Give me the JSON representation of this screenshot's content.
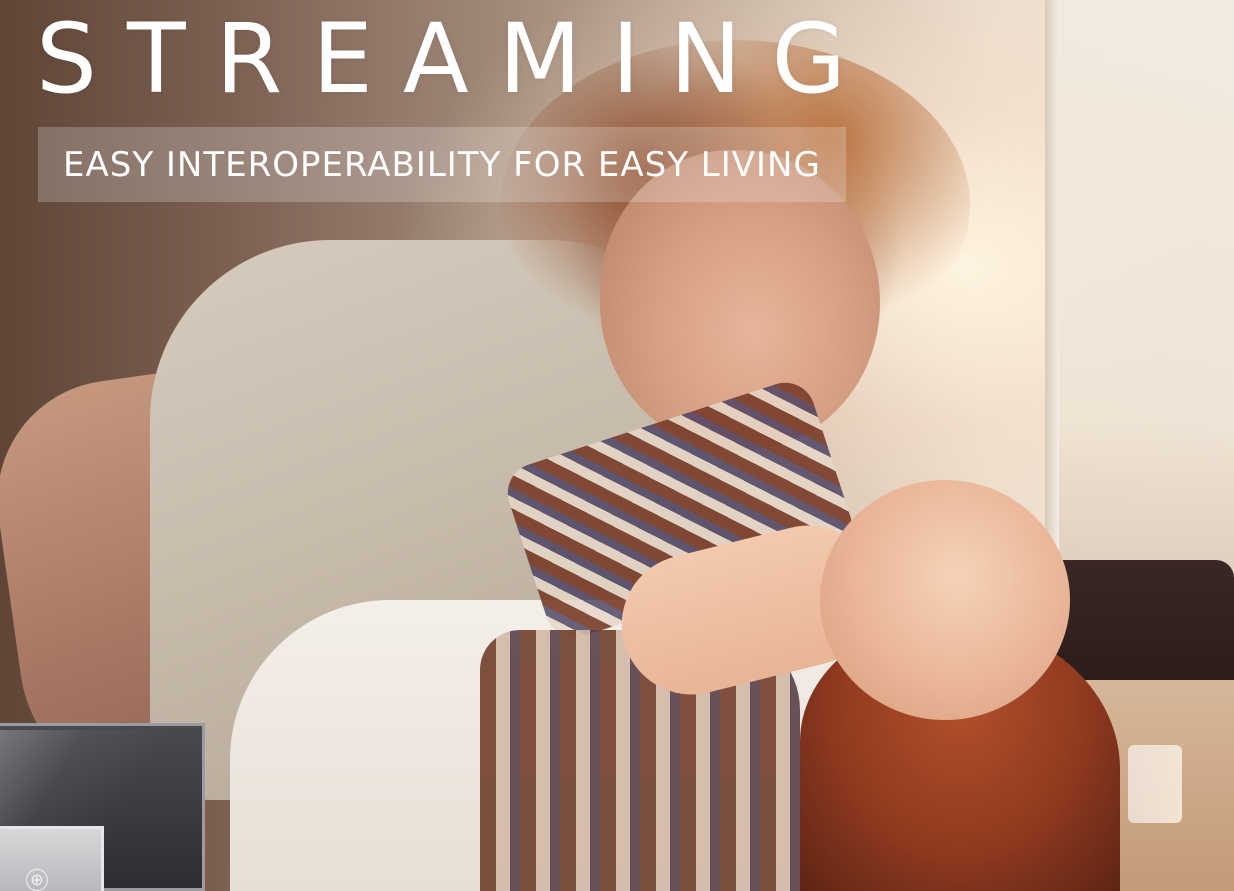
{
  "hero": {
    "title": "STREAMING",
    "tagline": "EASY INTEROPERABILITY FOR EASY LIVING"
  },
  "device": {
    "icon": "plus-circle-icon",
    "icon_glyph": "⊕"
  },
  "colors": {
    "text": "#ffffff",
    "tagline_box": "rgba(255,255,255,0.22)"
  }
}
